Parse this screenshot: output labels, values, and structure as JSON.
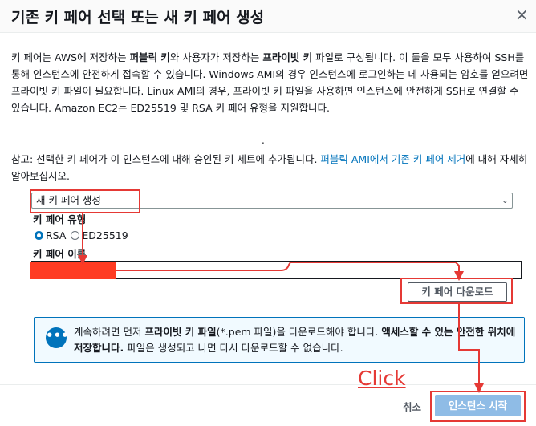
{
  "dialog": {
    "title": "기존 키 페어 선택 또는 새 키 페어 생성",
    "close_glyph": "×"
  },
  "description": {
    "s1": "키 페어는 AWS에 저장하는 ",
    "b1": "퍼블릭 키",
    "s2": "와 사용자가 저장하는 ",
    "b2": "프라이빗 키",
    "s3": " 파일로 구성됩니다. 이 둘을 모두 사용하여 SSH를 통해 인스턴스에 안전하게 접속할 수 있습니다. Windows AMI의 경우 인스턴스에 로그인하는 데 사용되는 암호를 얻으려면 프라이빗 키 파일이 필요합니다. Linux AMI의 경우, 프라이빗 키 파일을 사용하면 인스턴스에 안전하게 SSH로 연결할 수 있습니다. Amazon EC2는 ED25519 및 RSA 키 페어 유형을 지원합니다.",
    "dot": "."
  },
  "note": {
    "prefix": "참고: 선택한 키 페어가 이 인스턴스에 대해 승인된 키 세트에 추가됩니다. ",
    "link": "퍼블릭 AMI에서 기존 키 페어 제거",
    "suffix": "에 대해 자세히 알아보십시오."
  },
  "form": {
    "select_value": "새 키 페어 생성",
    "type_label": "키 페어 유형",
    "radio_rsa": "RSA",
    "radio_ed25519": "ED25519",
    "selected_type": "RSA",
    "name_label": "키 페어 이름",
    "download_button": "키 페어 다운로드"
  },
  "info_box": {
    "t1": "계속하려면 먼저 ",
    "b1": "프라이빗 키 파일",
    "t2": "(*.pem 파일)을 다운로드해야 합니다. ",
    "b2": "액세스할 수 있는 안전한 위치에 저장합니다.",
    "t3": " 파일은 생성되고 나면 다시 다운로드할 수 없습니다."
  },
  "footer": {
    "cancel": "취소",
    "launch": "인스턴스 시작"
  },
  "annotation": {
    "click_text": "Click",
    "color": "#e53935"
  },
  "colors": {
    "accent": "#0073bb",
    "launch_disabled": "#8fbce6",
    "redaction": "#ff3b22"
  }
}
